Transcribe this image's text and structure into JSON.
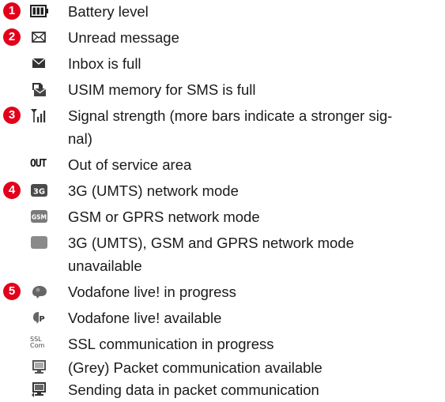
{
  "badges": [
    "1",
    "2",
    "3",
    "4",
    "5"
  ],
  "icons": {
    "battery": "battery-level-icon",
    "unread": "envelope-icon",
    "inbox_full": "envelope-filled-icon",
    "usim_full": "sim-envelope-icon",
    "signal": "signal-bars-icon",
    "out_of_service": "out-text-icon",
    "umts": "3g-icon",
    "gsm": "gsm-icon",
    "unavailable": "grey-square-icon",
    "live_in_progress": "live-in-progress-icon",
    "live_available": "live-available-icon",
    "ssl": "ssl-icon",
    "packet_available": "monitor-grey-icon",
    "packet_sending": "monitor-sending-icon"
  },
  "icon_text": {
    "umts": "3G",
    "gsm": "GSM",
    "out": "OUT",
    "ssl_line1": "SSL",
    "ssl_line2": "Com"
  },
  "items": [
    "Battery level",
    "Unread message",
    "Inbox is full",
    "USIM memory for SMS is full",
    "Signal strength (more bars indicate a stronger sig-\nnal)",
    "Out of service area",
    "3G (UMTS) network mode",
    "GSM or GPRS network mode",
    "3G (UMTS), GSM and GPRS network mode unavailable",
    "Vodafone live! in progress",
    "Vodafone live! available",
    "SSL communication in progress",
    "(Grey) Packet communication available",
    "Sending data in packet communication"
  ],
  "colors": {
    "badge": "#e2001a",
    "icon_dark": "#333333",
    "icon_grey": "#888888",
    "text": "#1a1a1a"
  }
}
